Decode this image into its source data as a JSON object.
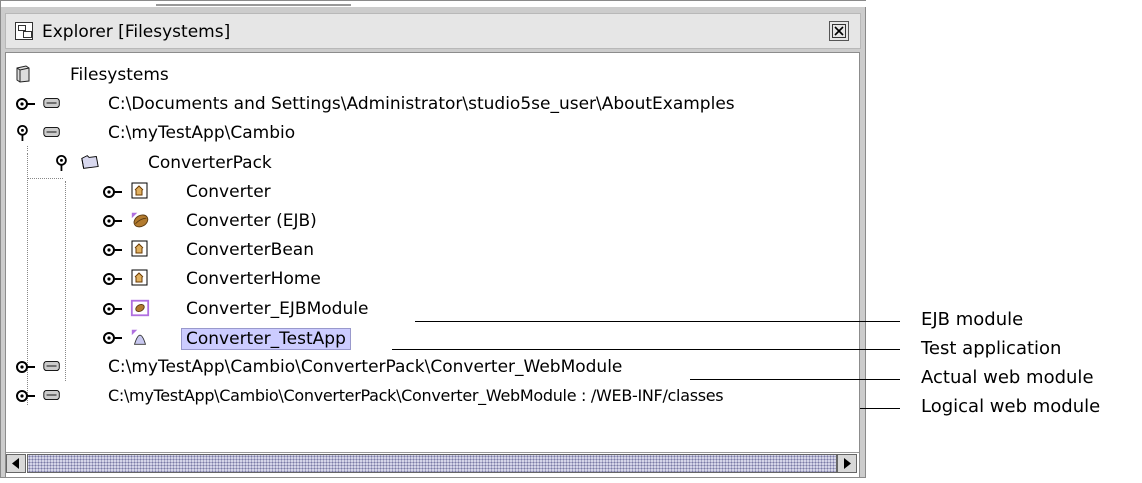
{
  "window": {
    "title": "Explorer [Filesystems]"
  },
  "tree": {
    "root_label": "Filesystems",
    "mount1": "C:\\Documents and Settings\\Administrator\\studio5se_user\\AboutExamples",
    "mount2": "C:\\myTestApp\\Cambio",
    "package": "ConverterPack",
    "items": [
      "Converter",
      "Converter (EJB)",
      "ConverterBean",
      "ConverterHome",
      "Converter_EJBModule",
      "Converter_TestApp"
    ],
    "mount3": "C:\\myTestApp\\Cambio\\ConverterPack\\Converter_WebModule",
    "mount4": "C:\\myTestApp\\Cambio\\ConverterPack\\Converter_WebModule : /WEB-INF/classes",
    "selected_item": "Converter_TestApp"
  },
  "callouts": {
    "ejb_module": "EJB module",
    "test_application": "Test application",
    "actual_web_module": "Actual web module",
    "logical_web_module": "Logical web module"
  },
  "colors": {
    "window_bg": "#cccccc",
    "selection_bg": "#ccccff",
    "scroll_track": "#d5d5e8"
  }
}
